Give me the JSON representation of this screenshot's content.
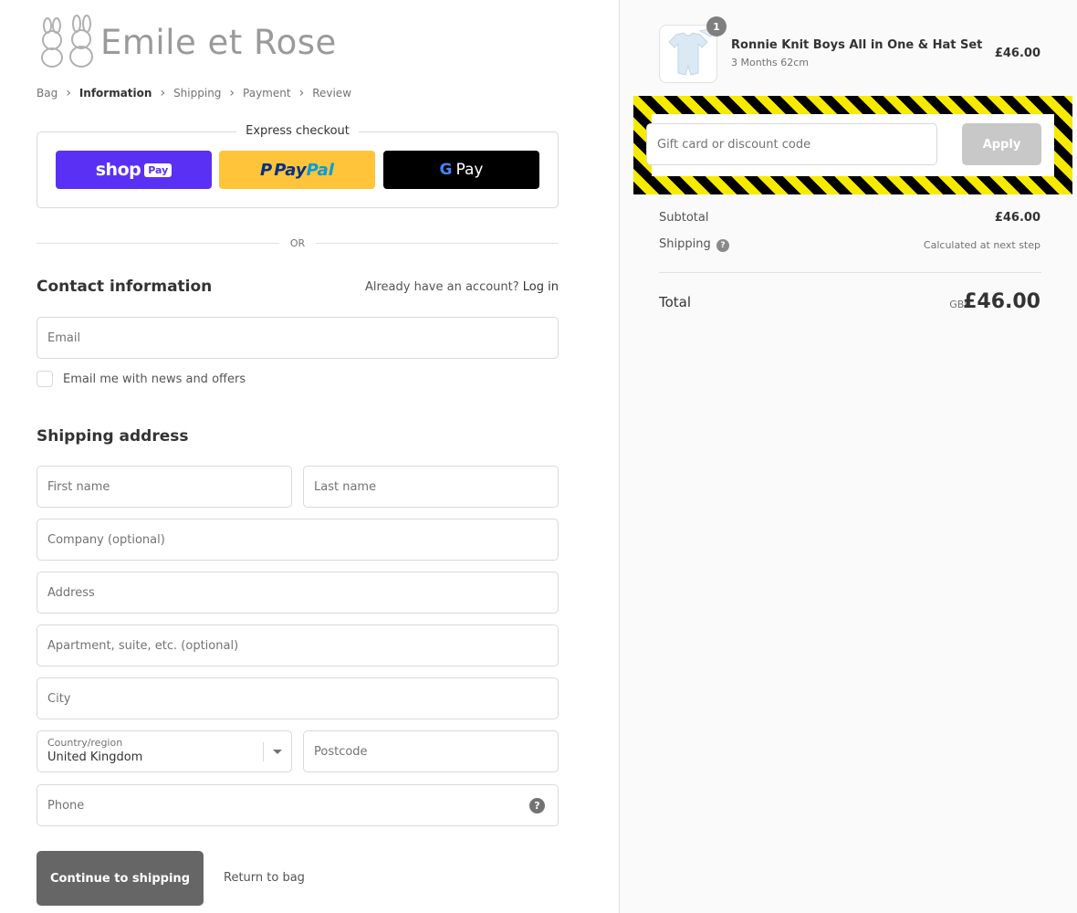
{
  "brand": {
    "name": "Emile et Rose"
  },
  "breadcrumb": [
    {
      "label": "Bag",
      "active": false
    },
    {
      "label": "Information",
      "active": true
    },
    {
      "label": "Shipping",
      "active": false
    },
    {
      "label": "Payment",
      "active": false
    },
    {
      "label": "Review",
      "active": false
    }
  ],
  "express": {
    "title": "Express checkout",
    "shop_pay": {
      "word": "shop",
      "pill": "Pay"
    },
    "paypal": {
      "p": "P",
      "word1": "Pay",
      "word2": "Pal"
    },
    "gpay": {
      "g": "G",
      "word": "Pay"
    }
  },
  "divider": {
    "or": "OR"
  },
  "contact": {
    "title": "Contact information",
    "account_prompt": "Already have an account?",
    "login_link": "Log in",
    "email_placeholder": "Email",
    "newsletter_label": "Email me with news and offers"
  },
  "shipping": {
    "title": "Shipping address",
    "first_name": "First name",
    "last_name": "Last name",
    "company": "Company (optional)",
    "address": "Address",
    "apartment": "Apartment, suite, etc. (optional)",
    "city": "City",
    "country_label": "Country/region",
    "country_value": "United Kingdom",
    "postcode": "Postcode",
    "phone": "Phone"
  },
  "actions": {
    "continue": "Continue to shipping",
    "return": "Return to bag"
  },
  "summary": {
    "product": {
      "name": "Ronnie Knit Boys All in One & Hat Set",
      "variant": "3 Months 62cm",
      "price": "£46.00",
      "quantity": "1"
    },
    "discount_placeholder": "Gift card or discount code",
    "apply": "Apply",
    "subtotal_label": "Subtotal",
    "subtotal_value": "£46.00",
    "shipping_label": "Shipping",
    "shipping_value": "Calculated at next step",
    "total_label": "Total",
    "currency": "GBP",
    "total_value": "£46.00"
  },
  "icons": {
    "help": "?",
    "chevron": "›"
  },
  "colors": {
    "shop_pay": "#5a31f4",
    "paypal": "#ffc439",
    "gpay": "#000000",
    "continue_button": "#666666",
    "hazard_yellow": "#f6ea00"
  }
}
